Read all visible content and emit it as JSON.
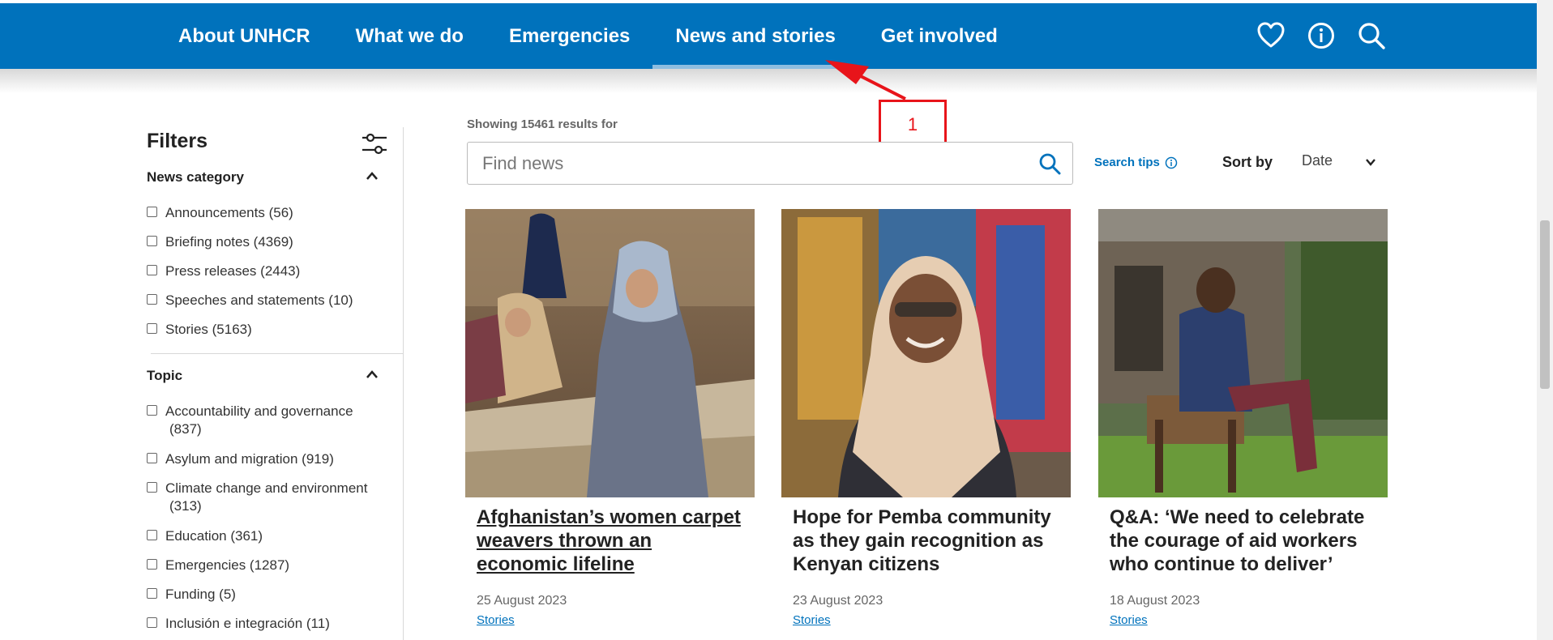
{
  "nav": {
    "items": [
      {
        "label": "About UNHCR"
      },
      {
        "label": "What we do"
      },
      {
        "label": "Emergencies"
      },
      {
        "label": "News and stories"
      },
      {
        "label": "Get involved"
      }
    ],
    "active_index": 3,
    "icons": [
      "heart-icon",
      "info-icon",
      "search-icon"
    ],
    "bg_color": "#0072bc"
  },
  "annotation": {
    "label": "1",
    "color": "#e8141a"
  },
  "sidebar": {
    "title": "Filters",
    "news_category": {
      "title": "News category",
      "options": [
        {
          "label": "Announcements (56)"
        },
        {
          "label": "Briefing notes (4369)"
        },
        {
          "label": "Press releases (2443)"
        },
        {
          "label": "Speeches and statements (10)"
        },
        {
          "label": "Stories (5163)"
        }
      ]
    },
    "topic": {
      "title": "Topic",
      "options": [
        {
          "label": "Accountability and governance",
          "count": "(837)"
        },
        {
          "label": "Asylum and migration (919)",
          "count": ""
        },
        {
          "label": "Climate change and environment",
          "count": "(313)"
        },
        {
          "label": "Education (361)",
          "count": ""
        },
        {
          "label": "Emergencies (1287)",
          "count": ""
        },
        {
          "label": "Funding (5)",
          "count": ""
        },
        {
          "label": "Inclusión e integración (11)",
          "count": ""
        }
      ]
    }
  },
  "search": {
    "results_text": "Showing 15461 results for",
    "placeholder": "Find news",
    "tips_label": "Search tips",
    "sort_label": "Sort by",
    "sort_value": "Date"
  },
  "cards": [
    {
      "title": "Afghanistan’s women carpet weavers thrown an economic lifeline",
      "date": "25 August 2023",
      "tag": "Stories"
    },
    {
      "title": "Hope for Pemba community as they gain recognition as Kenyan citizens",
      "date": "23 August 2023",
      "tag": "Stories"
    },
    {
      "title": "Q&A: ‘We need to celebrate the courage of aid workers who continue to deliver’",
      "date": "18 August 2023",
      "tag": "Stories"
    }
  ]
}
